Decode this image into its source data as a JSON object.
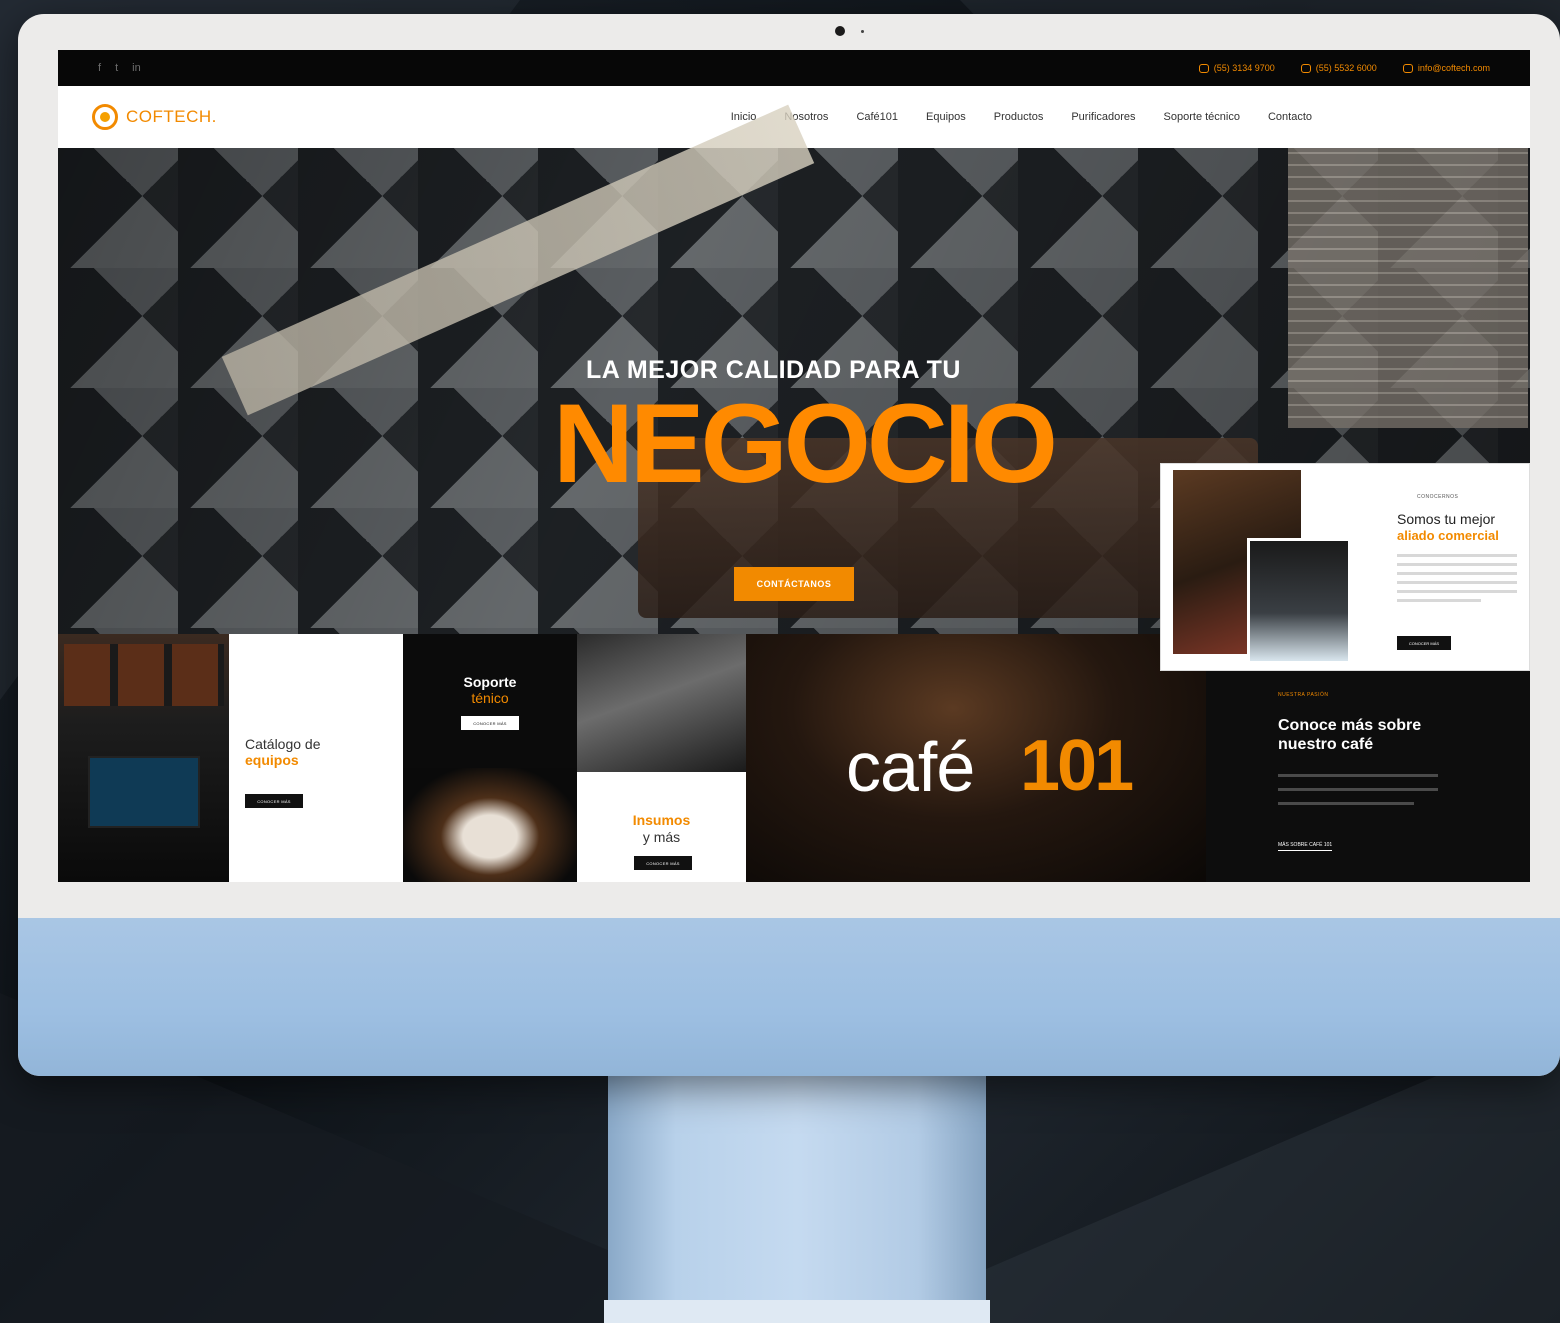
{
  "topbar": {
    "social": [
      "f",
      "t",
      "in"
    ],
    "phone1": "(55) 3134 9700",
    "phone2": "(55) 5532 6000",
    "email": "info@coftech.com"
  },
  "brand": {
    "name": "COFTECH."
  },
  "nav": [
    "Inicio",
    "Nosotros",
    "Café101",
    "Equipos",
    "Productos",
    "Purificadores",
    "Soporte técnico",
    "Contacto"
  ],
  "hero": {
    "title_small": "LA MEJOR CALIDAD PARA TU",
    "title_big": "NEGOCIO",
    "cta": "CONTÁCTANOS"
  },
  "ally": {
    "kicker": "CONOCERNOS",
    "title1": "Somos tu mejor",
    "title2": "aliado comercial",
    "button": "CONOCER MÁS"
  },
  "tiles": {
    "catalog": {
      "title1": "Catálogo de",
      "title2": "equipos",
      "button": "CONOCER MÁS"
    },
    "support": {
      "title1": "Soporte",
      "title2": "ténico",
      "button": "CONOCER MÁS"
    },
    "supplies": {
      "title1": "Insumos",
      "title2": "y más",
      "button": "CONOCER MÁS"
    },
    "cafe101": {
      "word": "café",
      "number": "101"
    },
    "passion": {
      "kicker": "NUESTRA PASIÓN",
      "title": "Conoce más sobre nuestro café",
      "link": "MÁS SOBRE CAFÉ 101"
    }
  },
  "colors": {
    "accent": "#f28a00",
    "dark": "#0b0b0b",
    "monitor_chin": "#a9c6e4"
  }
}
